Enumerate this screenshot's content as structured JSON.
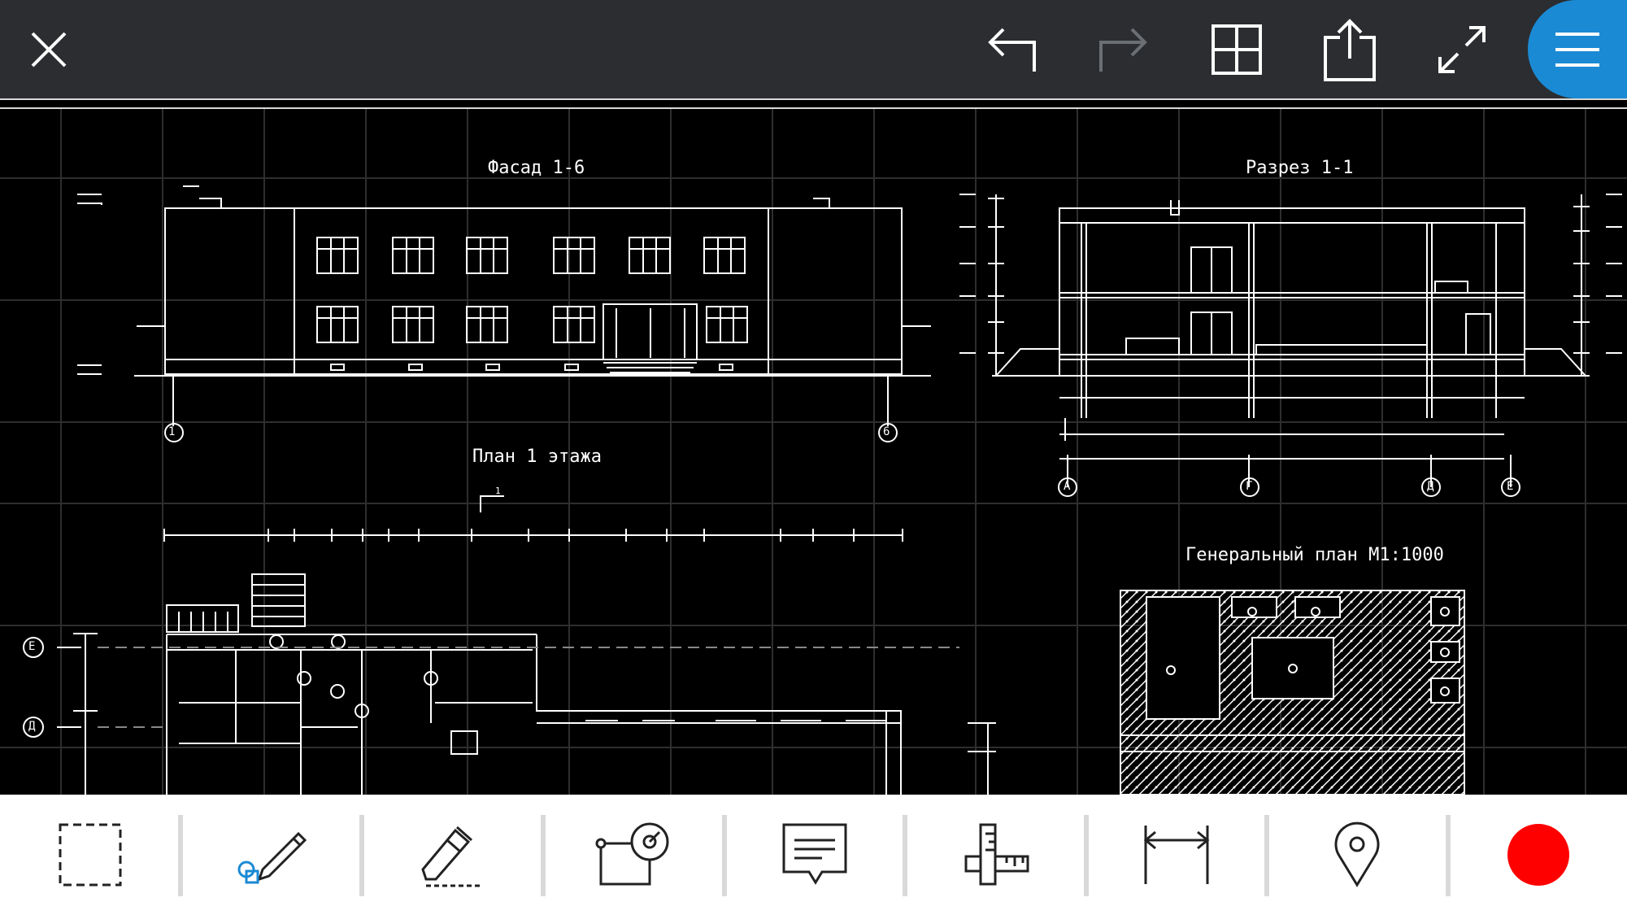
{
  "toolbar": {
    "close": "close-icon",
    "undo": "undo-icon",
    "redo": "redo-icon",
    "layouts": "layout-grid-icon",
    "share": "share-icon",
    "fullscreen": "fullscreen-icon",
    "menu": "hamburger-menu-icon",
    "accent_color": "#1a8ad4",
    "redo_enabled": false
  },
  "drawing": {
    "facade_title": "Фасад 1-6",
    "section_title": "Разрез 1-1",
    "plan_title": "План 1 этажа",
    "site_plan_title": "Генеральный план М1:1000",
    "axis_markers": [
      "1",
      "6",
      "А",
      "Г",
      "Д",
      "Е",
      "Е",
      "Д"
    ],
    "section_mark": "1"
  },
  "bottom_tools": [
    {
      "name": "select-tool",
      "icon": "dashed-rectangle-icon"
    },
    {
      "name": "draw-tool",
      "icon": "pencil-shapes-icon"
    },
    {
      "name": "text-tool",
      "icon": "marker-icon"
    },
    {
      "name": "shapes-tool",
      "icon": "shapes-icon"
    },
    {
      "name": "comment-tool",
      "icon": "comment-icon"
    },
    {
      "name": "measure-tool",
      "icon": "ruler-icon"
    },
    {
      "name": "dimension-tool",
      "icon": "dimension-icon"
    },
    {
      "name": "location-tool",
      "icon": "location-pin-icon"
    },
    {
      "name": "record-tool",
      "icon": "record-icon",
      "color": "#ff0000"
    }
  ]
}
